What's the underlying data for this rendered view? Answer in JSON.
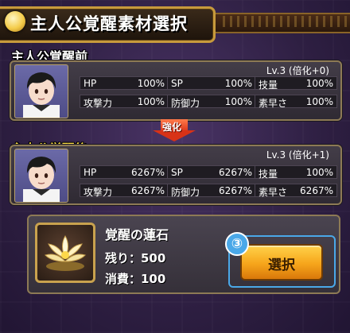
{
  "header": {
    "title": "主人公覚醒素材選択",
    "icon": "gold-coin-icon"
  },
  "before": {
    "label": "主人公覚醒前",
    "level": "Lv.3 (倍化+0)",
    "stats": [
      {
        "label": "HP",
        "value": "100%"
      },
      {
        "label": "SP",
        "value": "100%"
      },
      {
        "label": "技量",
        "value": "100%"
      },
      {
        "label": "攻撃力",
        "value": "100%"
      },
      {
        "label": "防御力",
        "value": "100%"
      },
      {
        "label": "素早さ",
        "value": "100%"
      }
    ]
  },
  "arrow": {
    "label": "強化"
  },
  "after": {
    "label": "主人公覚醒後",
    "level": "Lv.3 (倍化+1)",
    "stats": [
      {
        "label": "HP",
        "value": "6267%"
      },
      {
        "label": "SP",
        "value": "6267%"
      },
      {
        "label": "技量",
        "value": "100%"
      },
      {
        "label": "攻撃力",
        "value": "6267%"
      },
      {
        "label": "防御力",
        "value": "6267%"
      },
      {
        "label": "素早さ",
        "value": "6267%"
      }
    ]
  },
  "item": {
    "name": "覚醒の蓮石",
    "remaining": "残り：500",
    "consume": "消費：100",
    "icon": "lotus-stone-icon"
  },
  "select_button": {
    "label": "選択",
    "step": "③"
  },
  "colors": {
    "accent_gold": "#ffe14a",
    "button_orange": "#f6a51b",
    "highlight_blue": "#4aa8e8"
  }
}
